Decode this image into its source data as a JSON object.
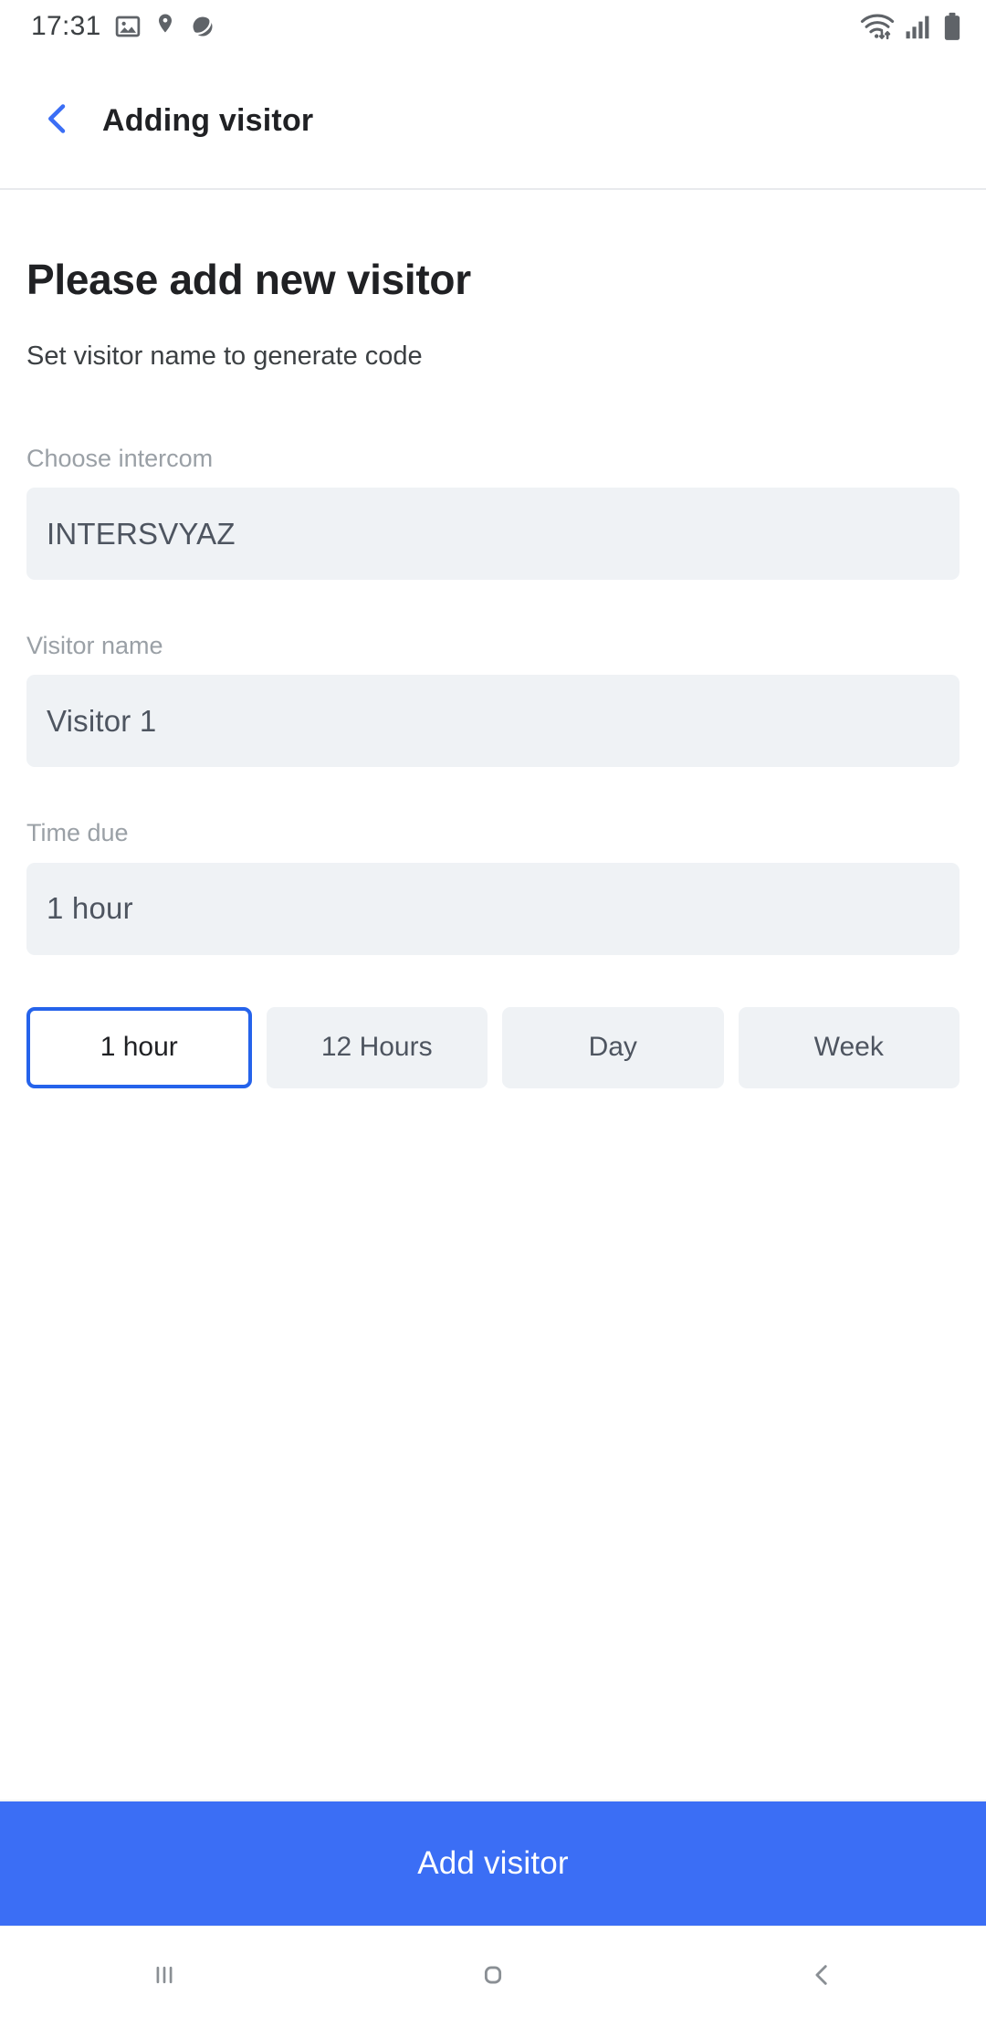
{
  "status_bar": {
    "time": "17:31",
    "left_icons": [
      "photo-icon",
      "location-pin-icon",
      "planet-icon"
    ],
    "right_icons": [
      "wifi-icon",
      "cellular-signal-icon",
      "battery-icon"
    ]
  },
  "app_bar": {
    "back_icon": "chevron-left-icon",
    "title": "Adding visitor",
    "accent_color": "#3b6ef5"
  },
  "main": {
    "title": "Please add new visitor",
    "subtitle": "Set visitor name to generate code",
    "fields": [
      {
        "label": "Choose intercom",
        "value": "INTERSVYAZ"
      },
      {
        "label": "Visitor name",
        "value": "Visitor 1"
      },
      {
        "label": "Time due",
        "value": "1 hour"
      }
    ],
    "duration_chips": [
      {
        "label": "1 hour",
        "selected": true
      },
      {
        "label": "12 Hours",
        "selected": false
      },
      {
        "label": "Day",
        "selected": false
      },
      {
        "label": "Week",
        "selected": false
      }
    ]
  },
  "cta": {
    "label": "Add visitor",
    "color": "#3b6ef5"
  },
  "nav_bar": {
    "recents_icon": "recents-icon",
    "home_icon": "home-icon",
    "back_icon": "back-icon"
  },
  "colors": {
    "field_background": "#eff2f5",
    "label_text": "#9aa0a6",
    "value_text": "#4e5560",
    "selected_border": "#2563eb"
  }
}
